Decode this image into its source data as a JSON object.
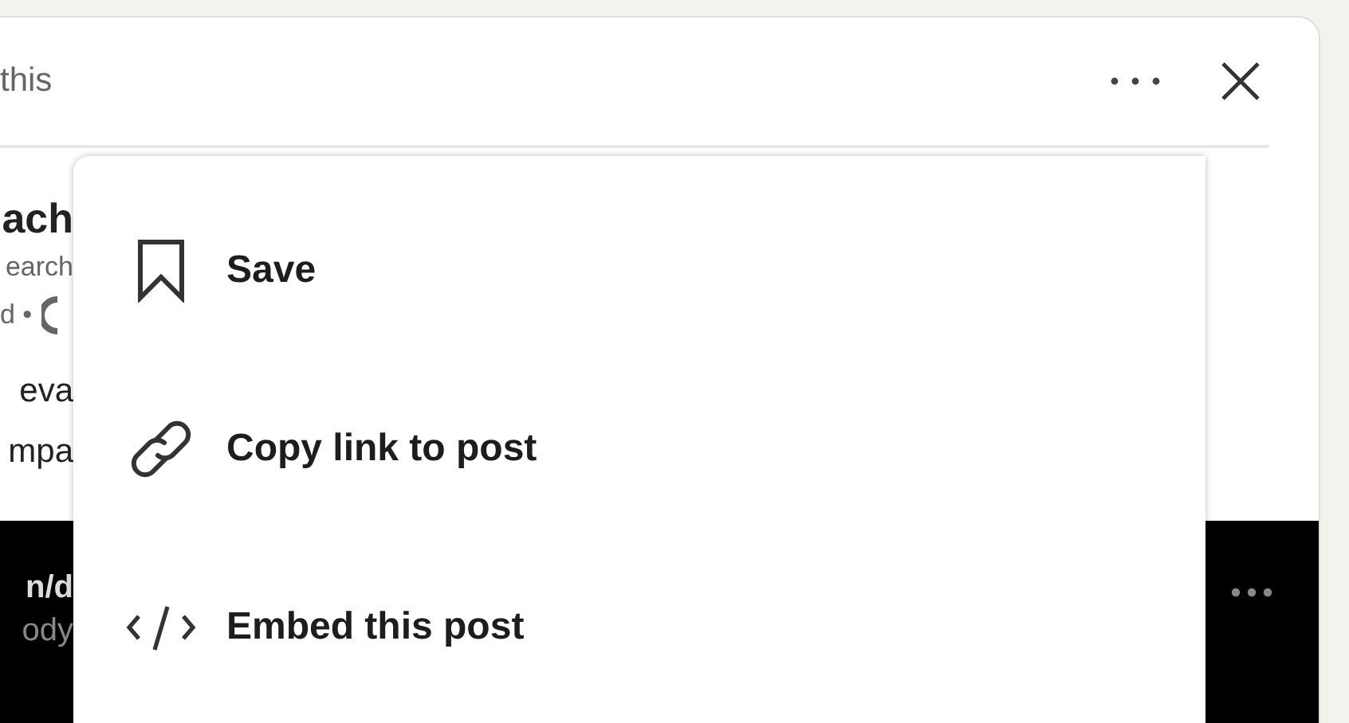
{
  "dialog": {
    "title": "this"
  },
  "post": {
    "title": "ach",
    "subtitle": "earch",
    "meta": "d •",
    "lines": [
      "eva",
      "mpa"
    ],
    "media_lines": [
      "n/d",
      "ody"
    ]
  },
  "menu": {
    "items": [
      {
        "kind": "bookmark",
        "label": "Save"
      },
      {
        "kind": "link",
        "label": "Copy link to post"
      },
      {
        "kind": "code",
        "label": "Embed this post"
      }
    ]
  }
}
